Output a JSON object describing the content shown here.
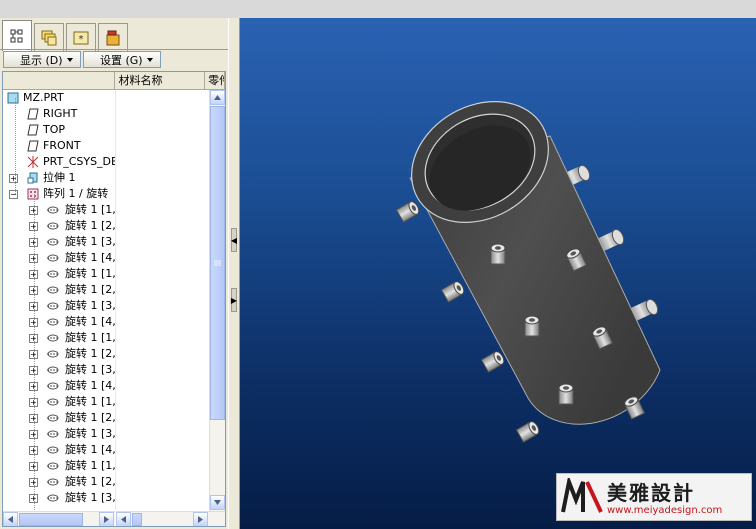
{
  "tabs": [
    {
      "icon": "model-tree-icon",
      "active": true
    },
    {
      "icon": "layers-icon",
      "active": false
    },
    {
      "icon": "favorites-icon",
      "active": false
    },
    {
      "icon": "tools-icon",
      "active": false
    }
  ],
  "toolbar": {
    "show_label": "显示 (D)",
    "settings_label": "设置 (G)"
  },
  "columns": {
    "material": "材料名称",
    "part": "零件"
  },
  "tree": {
    "root": "MZ.PRT",
    "datums": [
      "RIGHT",
      "TOP",
      "FRONT"
    ],
    "csys": "PRT_CSYS_DE",
    "extrude": "拉伸 1",
    "pattern": "阵列 1 / 旋转",
    "pattern_items": [
      "旋转 1 [1,",
      "旋转 1 [2,",
      "旋转 1 [3,",
      "旋转 1 [4,",
      "旋转 1 [1,",
      "旋转 1 [2,",
      "旋转 1 [3,",
      "旋转 1 [4,",
      "旋转 1 [1,",
      "旋转 1 [2,",
      "旋转 1 [3,",
      "旋转 1 [4,",
      "旋转 1 [1,",
      "旋转 1 [2,",
      "旋转 1 [3,",
      "旋转 1 [4,",
      "旋转 1 [1,",
      "旋转 1 [2,",
      "旋转 1 [3,"
    ]
  },
  "watermark": {
    "title": "美雅設計",
    "url": "www.meiyadesign.com"
  },
  "colors": {
    "viewport_top": "#2a62b3",
    "viewport_bottom": "#051d46",
    "cylinder": "#4a4a4a",
    "watermark_red": "#c4161c"
  }
}
